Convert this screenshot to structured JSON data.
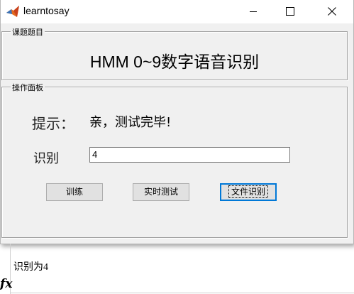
{
  "window": {
    "title": "learntosay"
  },
  "topic_panel": {
    "legend": "课题题目",
    "heading": "HMM 0~9数字语音识别"
  },
  "control_panel": {
    "legend": "操作面板",
    "hint_label": "提示：",
    "hint_value": "亲，测试完毕!",
    "result_label": "识别",
    "result_value": "4",
    "buttons": {
      "train": "训练",
      "realtime_test": "实时测试",
      "file_recognize": "文件识别"
    }
  },
  "console": {
    "output": "识别为4",
    "fx_symbol": "fx"
  },
  "icons": {
    "app": "matlab-icon",
    "minimize": "minimize-icon",
    "maximize": "maximize-icon",
    "close": "close-icon"
  }
}
